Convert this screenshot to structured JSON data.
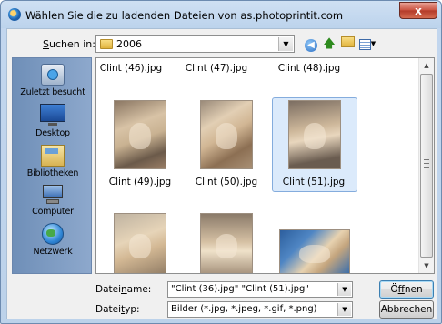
{
  "window": {
    "title": "Wählen Sie die zu ladenden Dateien von as.photoprintit.com",
    "close_label": "x"
  },
  "toolbar": {
    "look_in_label_pre": "S",
    "look_in_label_rest": "uchen in:",
    "look_in_value": "2006",
    "icons": [
      "back-icon",
      "up-folder-icon",
      "new-folder-icon",
      "view-menu-icon"
    ]
  },
  "places": [
    {
      "label": "Zuletzt besucht",
      "icon": "recent-places-icon"
    },
    {
      "label": "Desktop",
      "icon": "desktop-icon"
    },
    {
      "label": "Bibliotheken",
      "icon": "libraries-icon"
    },
    {
      "label": "Computer",
      "icon": "computer-icon"
    },
    {
      "label": "Netzwerk",
      "icon": "network-icon"
    }
  ],
  "files": {
    "top_row": [
      "Clint (46).jpg",
      "Clint (47).jpg",
      "Clint (48).jpg"
    ],
    "middle_row": [
      "Clint (49).jpg",
      "Clint (50).jpg",
      "Clint (51).jpg"
    ],
    "selected": "Clint (51).jpg"
  },
  "filename": {
    "label_pre": "Datei",
    "label_u": "n",
    "label_post": "ame:",
    "value": "\"Clint (36).jpg\" \"Clint (51).jpg\""
  },
  "filetype": {
    "label_pre": "Datei",
    "label_u": "t",
    "label_post": "yp:",
    "value": "Bilder (*.jpg, *.jpeg, *.gif, *.png)"
  },
  "buttons": {
    "open_pre": "Ö",
    "open_u": "f",
    "open_post": "fnen",
    "cancel": "Abbrechen"
  },
  "colors": {
    "selection": "#dbeafb",
    "places_bar": "#7f9cc2",
    "close_button": "#c9503e"
  }
}
